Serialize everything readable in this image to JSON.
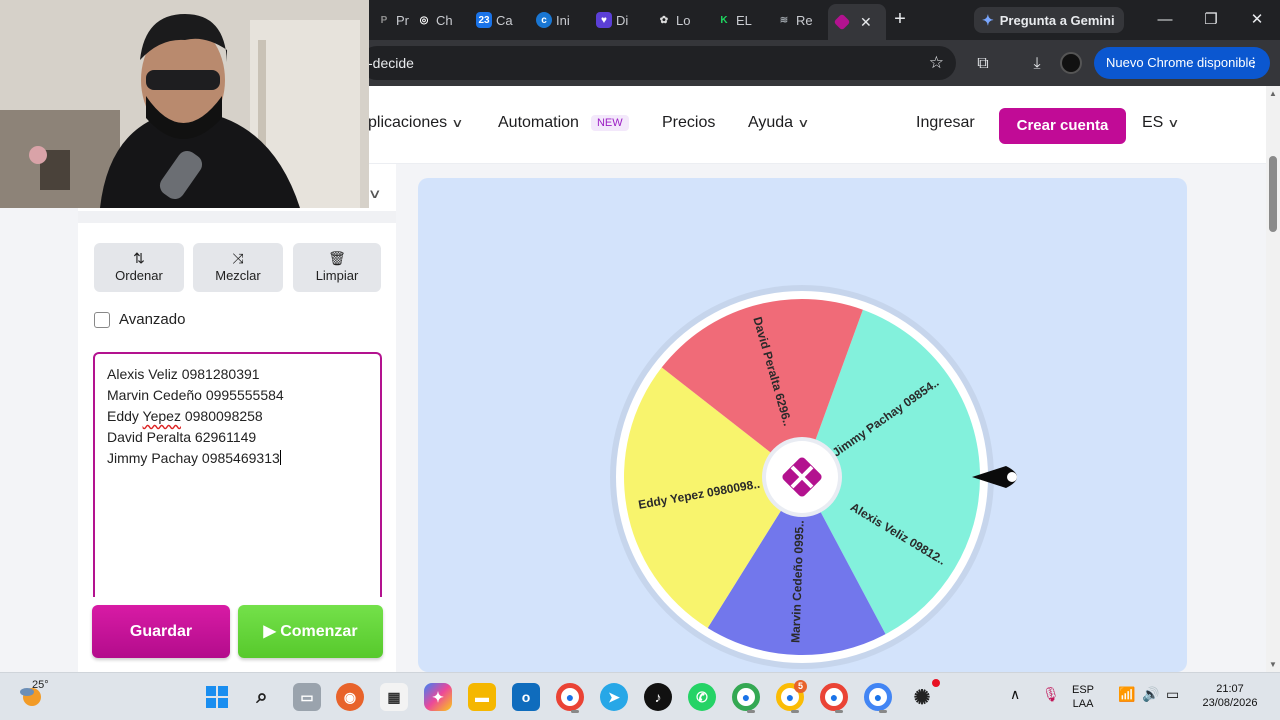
{
  "browser": {
    "tabs": [
      {
        "label": "Pr",
        "fav": "P",
        "color": "#8e8e8e"
      },
      {
        "label": "Ch",
        "fav": "◎",
        "color": "#ffffff"
      },
      {
        "label": "Ca",
        "fav": "23",
        "color": "#1a73e8"
      },
      {
        "label": "Ini",
        "fav": "c",
        "color": "#1976d2"
      },
      {
        "label": "Di",
        "fav": "♥",
        "color": "#5b3fd6"
      },
      {
        "label": "Lo",
        "fav": "✿",
        "color": "#dddddd"
      },
      {
        "label": "EL",
        "fav": "K",
        "color": "#1ed760"
      },
      {
        "label": "Re",
        "fav": "≋",
        "color": "#9aa0a6"
      }
    ],
    "active_tab_close": "✕",
    "new_tab": "+",
    "gemini_label": "Pregunta a Gemini",
    "window_controls": {
      "minimize": "—",
      "restore": "❐",
      "close": "✕"
    },
    "url": "-decide",
    "update_chip": "Nuevo Chrome disponible",
    "update_chip_menu": "⋮"
  },
  "nav": {
    "aplicaciones": "plicaciones",
    "automation": "Automation",
    "automation_badge": "NEW",
    "precios": "Precios",
    "ayuda": "Ayuda",
    "ingresar": "Ingresar",
    "crear_cuenta": "Crear cuenta",
    "language": "ES",
    "chevron": "⌄"
  },
  "tools": {
    "ordenar": "Ordenar",
    "mezclar": "Mezclar",
    "limpiar": "Limpiar"
  },
  "advanced_label": "Avanzado",
  "names": [
    "Alexis Veliz 0981280391",
    "Marvin Cedeño 0995555584",
    "Eddy Yepez 0980098258",
    "David Peralta 62961149",
    "Jimmy Pachay 0985469313"
  ],
  "names_spell_error_word": "Yepez",
  "actions": {
    "guardar": "Guardar",
    "comenzar": "Comenzar",
    "comenzar_icon": "▶"
  },
  "wheel": {
    "segments": [
      {
        "label": "Jimmy Pachay 09854..",
        "color": "#83f1dc"
      },
      {
        "label": "Alexis Veliz 09812..",
        "color": "#83f1dc"
      },
      {
        "label": "Marvin Cedeño 0995..",
        "color": "#7277ec"
      },
      {
        "label": "Eddy Yepez 0980098..",
        "color": "#f8f46d"
      },
      {
        "label": "David Peralta 6296..",
        "color": "#f06b78"
      }
    ],
    "hub_color": "#b3128f",
    "rim_color": "#ffffff"
  },
  "taskbar": {
    "temperature": "25°",
    "language": "ESP",
    "language_sub": "LAA",
    "time": "21:07",
    "date": "23/08/2026",
    "chrome_badge": "5"
  }
}
